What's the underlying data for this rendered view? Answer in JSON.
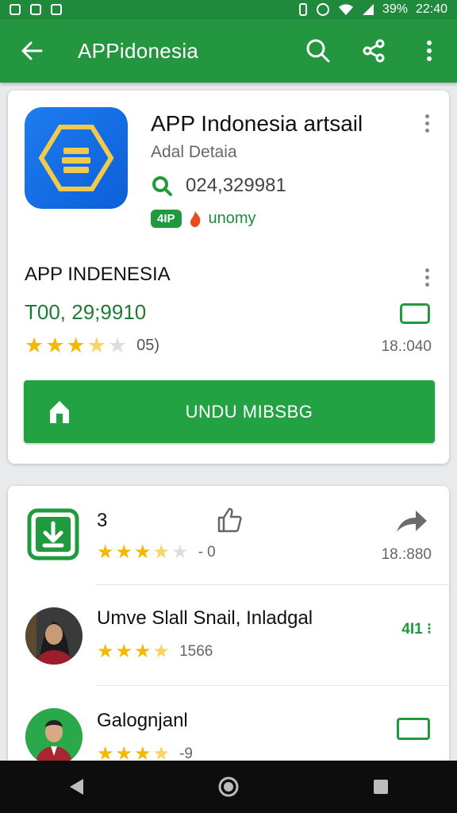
{
  "status_bar": {
    "battery": "39%",
    "time": "22:40"
  },
  "app_bar": {
    "title": "APPidonesia"
  },
  "app_card": {
    "title": "APP Indonesia artsail",
    "subtitle": "Adal Detaia",
    "count": "024,329981",
    "tag_badge": "4IP",
    "tag_text": "unomy",
    "section_title": "APP INDENESIA",
    "price": "T00, 29;9910",
    "rating_count": "05)",
    "right_value": "18.:040",
    "install_label": "UNDU MIBSBG",
    "rating_stars": 3.5
  },
  "list": {
    "rows": [
      {
        "title": "3",
        "rating_text": "- 0",
        "right_text": "18.:880",
        "stars": 3.5
      },
      {
        "title": "Umve Slall Snail, Inladgal",
        "rating_text": "1566",
        "right_text": "4I1 ⁝",
        "stars": 3.5
      },
      {
        "title": "Galognjanl",
        "rating_text": "-9",
        "stars": 3.5
      }
    ]
  },
  "colors": {
    "primary": "#24963f",
    "status": "#1f8a3b",
    "accent_star": "#f5b800",
    "icon_blue": "#1e7cf0"
  }
}
